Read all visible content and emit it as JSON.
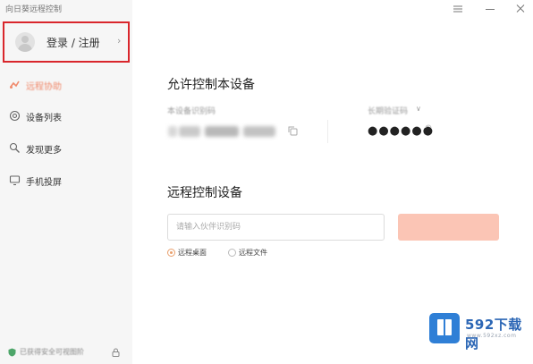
{
  "app": {
    "title": "向日葵远程控制"
  },
  "login": {
    "label": "登录 / 注册",
    "chevron": "›"
  },
  "sidebar": {
    "items": [
      {
        "label": "远程协助",
        "icon": "remote-icon",
        "active": true
      },
      {
        "label": "设备列表",
        "icon": "devices-icon",
        "active": false
      },
      {
        "label": "发现更多",
        "icon": "discover-icon",
        "active": false
      },
      {
        "label": "手机投屏",
        "icon": "screen-cast-icon",
        "active": false
      }
    ],
    "footer": {
      "label": "已获得安全可视图阶"
    }
  },
  "main": {
    "allow_title": "允许控制本设备",
    "device_id_label": "本设备识别码",
    "password_label": "长期验证码",
    "password_value": "●●●●●●",
    "remote_title": "远程控制设备",
    "remote_input_placeholder": "请输入伙伴识别码",
    "connect_label": "",
    "modes": [
      {
        "label": "远程桌面",
        "checked": true
      },
      {
        "label": "远程文件",
        "checked": false
      }
    ]
  },
  "watermark": {
    "text": "592下载网",
    "url": "www.592xz.com"
  },
  "colors": {
    "accent": "#f08a6c",
    "highlight_border": "#d9262c",
    "connect_button": "#fbc5b5",
    "watermark": "#2b66b5"
  }
}
